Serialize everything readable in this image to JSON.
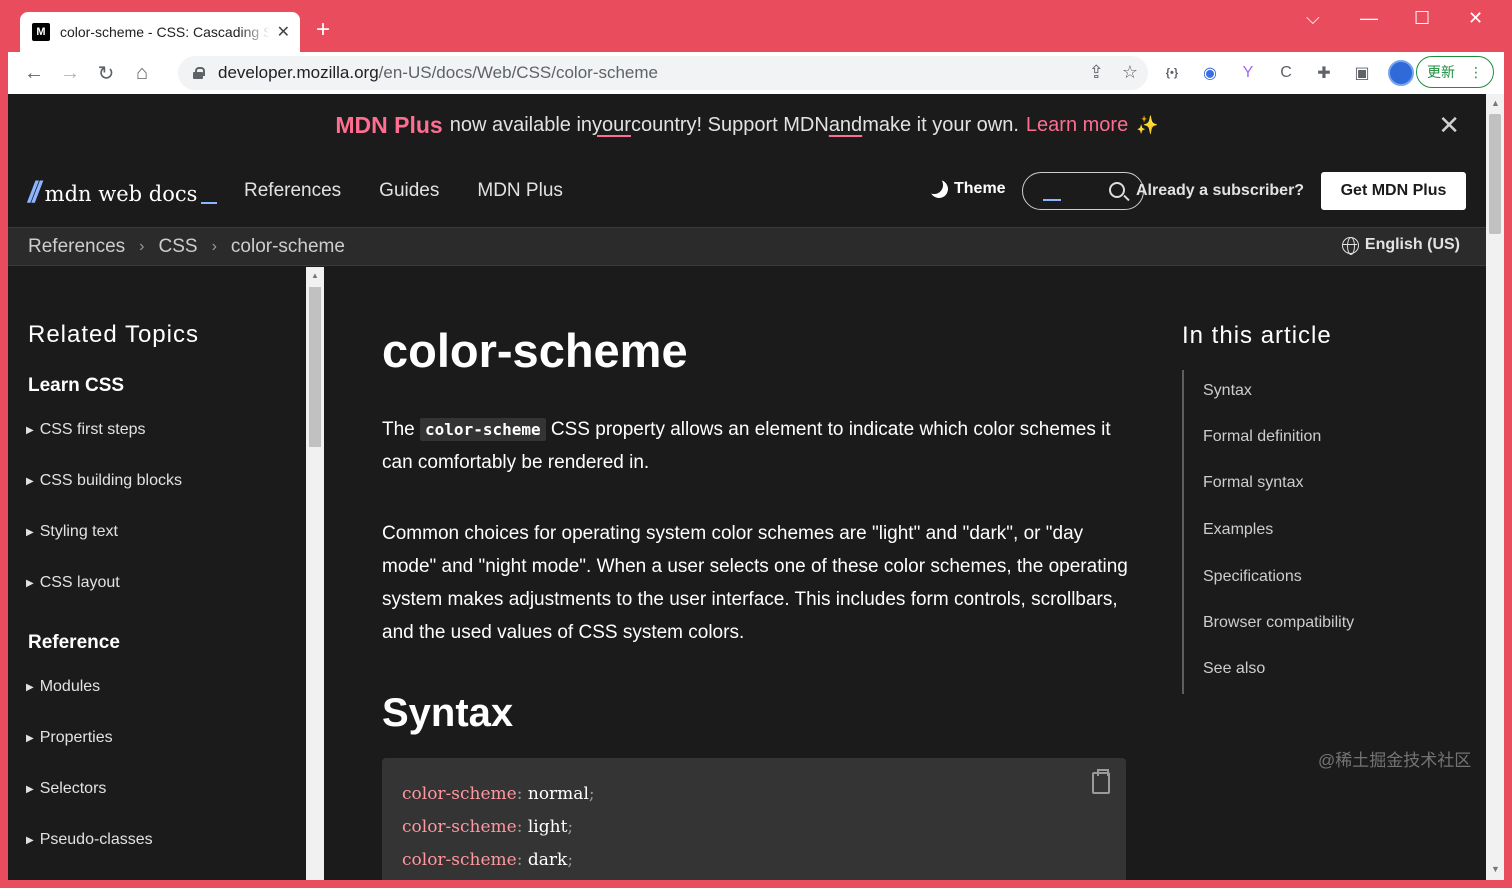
{
  "browser": {
    "tab_title": "color-scheme - CSS: Cascading Style Sheets | MDN",
    "tab_favicon": "M",
    "url_domain": "developer.mozilla.org",
    "url_path": "/en-US/docs/Web/CSS/color-scheme",
    "update_label": "更新",
    "titlebar_color": "#e84c5d"
  },
  "banner": {
    "brand": "MDN Plus",
    "t1": "now available in ",
    "t2": "your",
    "t3": " country! Support MDN ",
    "t4": "and",
    "t5": " make it your own.",
    "learn_more": "Learn more",
    "accent": "#ff6d91"
  },
  "nav": {
    "logo_text": "mdn web docs",
    "items": [
      "References",
      "Guides",
      "MDN Plus"
    ],
    "theme_label": "Theme",
    "subscriber_label": "Already a subscriber?",
    "cta_label": "Get MDN Plus"
  },
  "breadcrumbs": [
    "References",
    "CSS",
    "color-scheme"
  ],
  "language": "English (US)",
  "sidebar": {
    "title": "Related Topics",
    "learn_heading": "Learn CSS",
    "learn_items": [
      "CSS first steps",
      "CSS building blocks",
      "Styling text",
      "CSS layout"
    ],
    "reference_heading": "Reference",
    "reference_items": [
      "Modules",
      "Properties",
      "Selectors",
      "Pseudo-classes"
    ]
  },
  "article": {
    "title": "color-scheme",
    "intro_1": "The ",
    "intro_code": "color-scheme",
    "intro_2": " CSS property allows an element to indicate which color schemes it can comfortably be rendered in.",
    "para2": "Common choices for operating system color schemes are \"light\" and \"dark\", or \"day mode\" and \"night mode\". When a user selects one of these color schemes, the operating system makes adjustments to the user interface. This includes form controls, scrollbars, and the used values of CSS system colors.",
    "syntax_heading": "Syntax",
    "code_lines": [
      {
        "prop": "color-scheme",
        "value": "normal"
      },
      {
        "prop": "color-scheme",
        "value": "light"
      },
      {
        "prop": "color-scheme",
        "value": "dark"
      }
    ]
  },
  "toc": {
    "title": "In this article",
    "items": [
      "Syntax",
      "Formal definition",
      "Formal syntax",
      "Examples",
      "Specifications",
      "Browser compatibility",
      "See also"
    ]
  },
  "watermark": "@稀土掘金技术社区"
}
